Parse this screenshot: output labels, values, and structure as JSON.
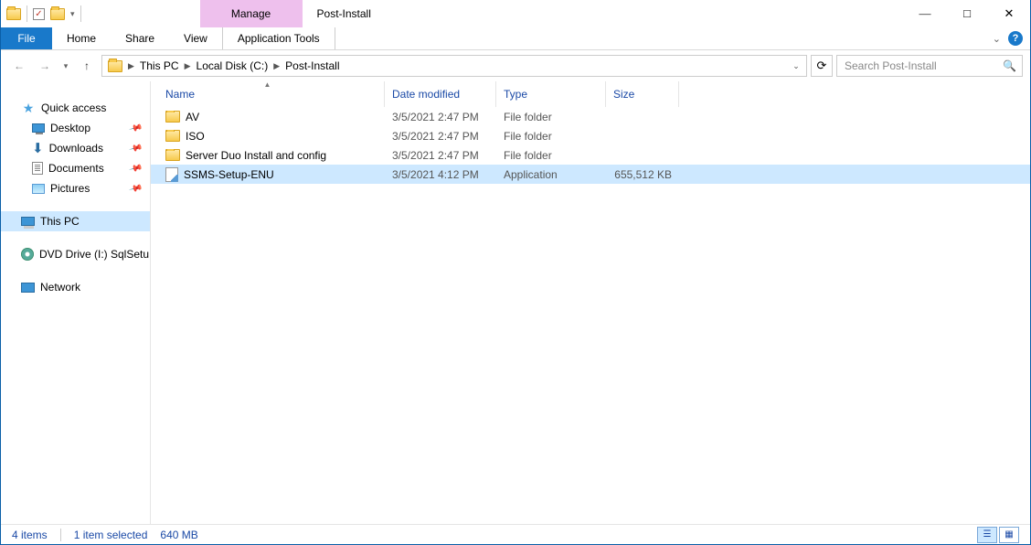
{
  "window": {
    "title": "Post-Install",
    "contextual_tab_group": "Manage",
    "contextual_tab": "Application Tools"
  },
  "ribbon": {
    "file": "File",
    "tabs": [
      "Home",
      "Share",
      "View"
    ]
  },
  "breadcrumbs": [
    "This PC",
    "Local Disk (C:)",
    "Post-Install"
  ],
  "search": {
    "placeholder": "Search Post-Install"
  },
  "columns": {
    "name": "Name",
    "date": "Date modified",
    "type": "Type",
    "size": "Size"
  },
  "nav": {
    "quick_access": "Quick access",
    "quick_items": [
      {
        "label": "Desktop",
        "icon": "desktop",
        "pinned": true
      },
      {
        "label": "Downloads",
        "icon": "download",
        "pinned": true
      },
      {
        "label": "Documents",
        "icon": "document",
        "pinned": true
      },
      {
        "label": "Pictures",
        "icon": "picture",
        "pinned": true
      }
    ],
    "this_pc": "This PC",
    "dvd": "DVD Drive (I:) SqlSetu",
    "network": "Network"
  },
  "files": [
    {
      "name": "AV",
      "date": "3/5/2021 2:47 PM",
      "type": "File folder",
      "size": "",
      "icon": "folder",
      "selected": false
    },
    {
      "name": "ISO",
      "date": "3/5/2021 2:47 PM",
      "type": "File folder",
      "size": "",
      "icon": "folder",
      "selected": false
    },
    {
      "name": "Server Duo Install and config",
      "date": "3/5/2021 2:47 PM",
      "type": "File folder",
      "size": "",
      "icon": "folder",
      "selected": false
    },
    {
      "name": "SSMS-Setup-ENU",
      "date": "3/5/2021 4:12 PM",
      "type": "Application",
      "size": "655,512 KB",
      "icon": "exe",
      "selected": true
    }
  ],
  "status": {
    "count": "4 items",
    "selection": "1 item selected",
    "size": "640 MB"
  }
}
